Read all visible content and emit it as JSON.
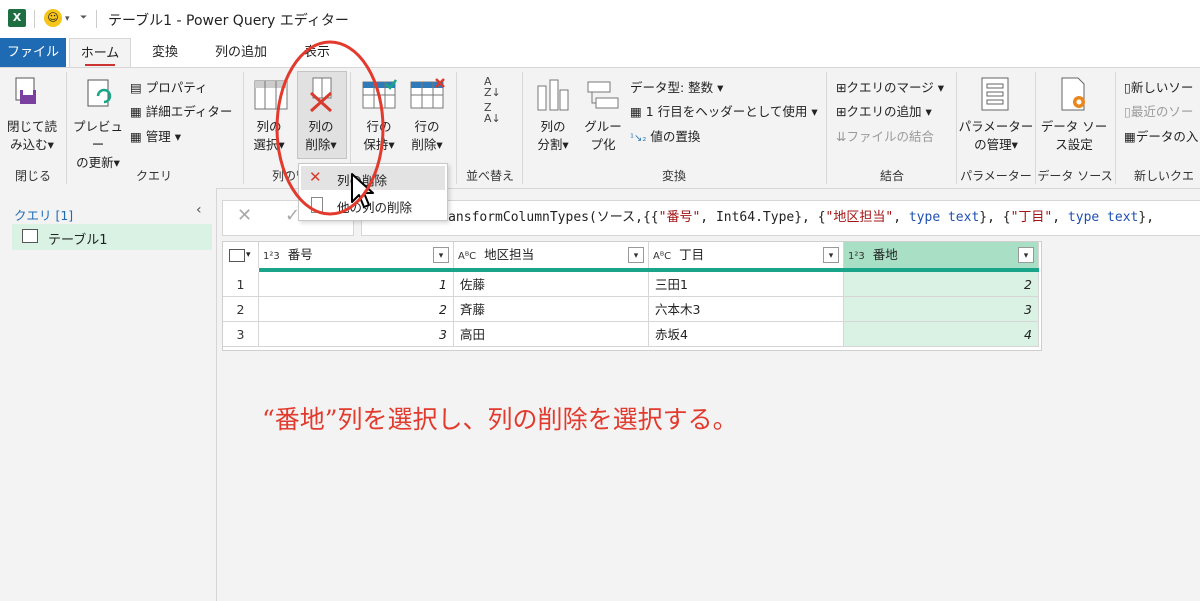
{
  "window": {
    "title": "テーブル1 - Power Query エディター",
    "app_icon": "X"
  },
  "menu_tabs": [
    "ファイル",
    "ホーム",
    "変換",
    "列の追加",
    "表示"
  ],
  "ribbon": {
    "close": {
      "btn_line1": "閉じて読",
      "btn_line2": "み込む▾",
      "group": "閉じる"
    },
    "query": {
      "preview_line1": "プレビュー",
      "preview_line2": "の更新▾",
      "properties": "プロパティ",
      "advanced_editor": "詳細エディター",
      "manage": "管理 ▾",
      "group": "クエリ"
    },
    "columns": {
      "choose_line1": "列の",
      "choose_line2": "選択▾",
      "remove_line1": "列の",
      "remove_line2": "削除▾",
      "group": "列の管理"
    },
    "rows": {
      "keep_line1": "行の",
      "keep_line2": "保持▾",
      "remove_line1": "行の",
      "remove_line2": "削除▾",
      "group": "行の削減"
    },
    "sort": {
      "group": "並べ替え"
    },
    "transform": {
      "split_line1": "列の",
      "split_line2": "分割▾",
      "group_line1": "グルー",
      "group_line2": "プ化",
      "datatype": "データ型: 整数 ▾",
      "first_row_header": "1 行目をヘッダーとして使用 ▾",
      "replace_values": "値の置換",
      "group": "変換"
    },
    "combine": {
      "merge": "クエリのマージ ▾",
      "append": "クエリの追加 ▾",
      "combine_files": "ファイルの結合",
      "group": "結合"
    },
    "params": {
      "line1": "パラメーター",
      "line2": "の管理▾",
      "group": "パラメーター"
    },
    "datasource": {
      "line1": "データ ソー",
      "line2": "ス設定",
      "group": "データ ソース"
    },
    "newquery": {
      "new_source": "新しいソー",
      "recent_source": "最近のソー",
      "enter_data": "データの入",
      "group": "新しいクエ"
    }
  },
  "dropdown_menu": {
    "item1": "列の削除",
    "item2": "他の列の削除"
  },
  "left_pane": {
    "header": "クエリ [1]",
    "items": [
      "テーブル1"
    ]
  },
  "formula": {
    "prefix": "= Table.TransformColumnTypes(ソース,{{",
    "s1": "\"番号\"",
    "t1": ", Int64.Type}, {",
    "s2": "\"地区担当\"",
    "t2": ", ",
    "k1": "type text",
    "t3": "}, {",
    "s3": "\"丁目\"",
    "t4": ", ",
    "k2": "type text",
    "t5": "},"
  },
  "table": {
    "columns": [
      {
        "type": "1²3",
        "name": "番号"
      },
      {
        "type": "AᴮC",
        "name": "地区担当"
      },
      {
        "type": "AᴮC",
        "name": "丁目"
      },
      {
        "type": "1²3",
        "name": "番地"
      }
    ],
    "rows": [
      {
        "n": "1",
        "c1": "1",
        "c2": "佐藤",
        "c3": "三田1",
        "c4": "2"
      },
      {
        "n": "2",
        "c1": "2",
        "c2": "斉藤",
        "c3": "六本木3",
        "c4": "3"
      },
      {
        "n": "3",
        "c1": "3",
        "c2": "高田",
        "c3": "赤坂4",
        "c4": "4"
      }
    ]
  },
  "annotation": "“番地”列を選択し、列の削除を選択する。",
  "colors": {
    "accent_blue": "#1f6bb3",
    "selection_green": "#d9f2e4",
    "header_teal": "#1aa58a",
    "annotation_red": "#e23a2d"
  }
}
